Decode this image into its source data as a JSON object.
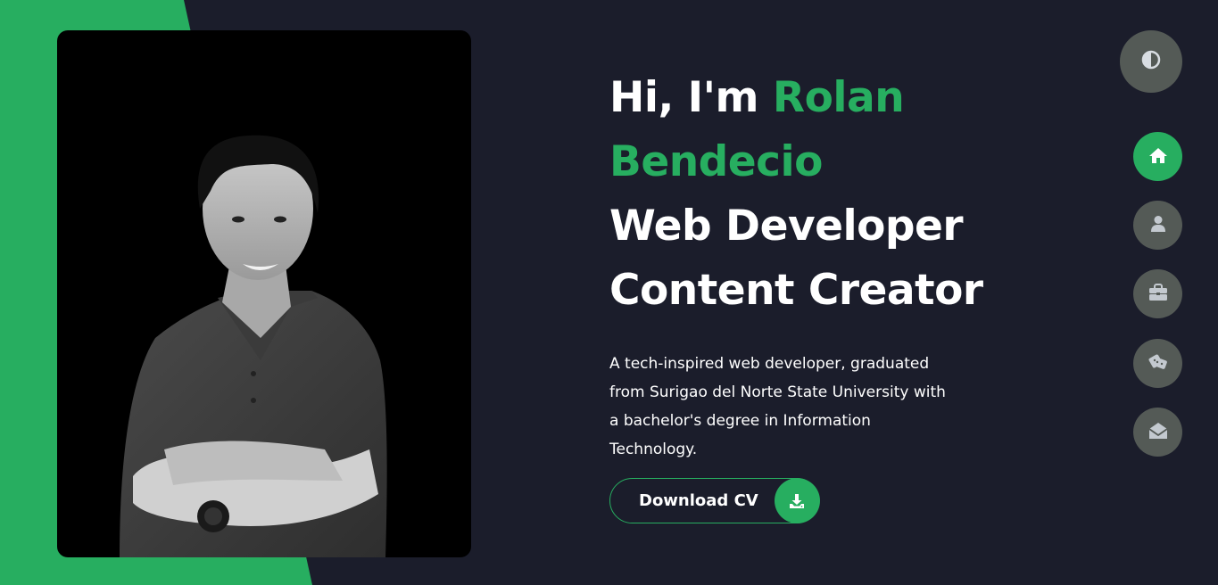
{
  "hero": {
    "greeting": "Hi, I'm",
    "name_first": "Rolan",
    "name_last": "Bendecio",
    "role_1": "Web Developer",
    "role_2": "Content Creator",
    "bio": "A tech-inspired web developer, graduated from Surigao del Norte State University with a bachelor's degree in Information Technology."
  },
  "cv_button": {
    "label": "Download CV",
    "icon": "download-icon"
  },
  "theme_toggle": {
    "icon": "contrast-icon"
  },
  "nav": {
    "items": [
      {
        "id": "home",
        "icon": "home-icon",
        "active": true
      },
      {
        "id": "about",
        "icon": "user-icon",
        "active": false
      },
      {
        "id": "portfolio",
        "icon": "briefcase-icon",
        "active": false
      },
      {
        "id": "blog",
        "icon": "blog-icon",
        "active": false
      },
      {
        "id": "contact",
        "icon": "envelope-open-icon",
        "active": false
      }
    ]
  },
  "colors": {
    "background": "#1b1d2b",
    "accent": "#27ae60",
    "nav_inactive": "#545a56",
    "text": "#ffffff"
  }
}
